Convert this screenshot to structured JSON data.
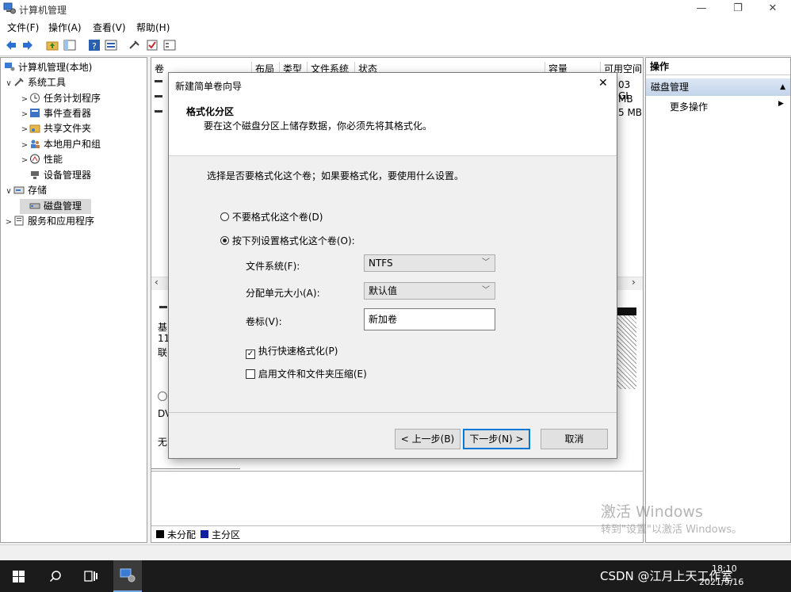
{
  "window": {
    "title": "计算机管理",
    "controls": {
      "minimize": "—",
      "maximize": "❐",
      "close": "✕"
    }
  },
  "menu": [
    "文件(F)",
    "操作(A)",
    "查看(V)",
    "帮助(H)"
  ],
  "tree": {
    "root": "计算机管理(本地)",
    "items": [
      {
        "label": "系统工具",
        "expander": "∨"
      },
      {
        "label": "任务计划程序",
        "expander": ">"
      },
      {
        "label": "事件查看器",
        "expander": ">"
      },
      {
        "label": "共享文件夹",
        "expander": ">"
      },
      {
        "label": "本地用户和组",
        "expander": ">"
      },
      {
        "label": "性能",
        "expander": ">"
      },
      {
        "label": "设备管理器",
        "expander": ""
      },
      {
        "label": "存储",
        "expander": "∨"
      },
      {
        "label": "磁盘管理",
        "expander": ""
      },
      {
        "label": "服务和应用程序",
        "expander": ">"
      }
    ]
  },
  "volume_list": {
    "columns": [
      "卷",
      "布局",
      "类型",
      "文件系统",
      "状态",
      "容量",
      "可用空间"
    ],
    "free_space_partial": [
      "03 GI",
      "MB",
      "5 MB"
    ]
  },
  "disk_map": {
    "partial_labels": [
      "基",
      "11",
      "联",
      "DV",
      "无"
    ],
    "legend": {
      "unallocated": "未分配",
      "primary": "主分区"
    }
  },
  "actions": {
    "header": "操作",
    "section": "磁盘管理",
    "more": "更多操作"
  },
  "watermark": {
    "line1": "激活 Windows",
    "line2": "转到\"设置\"以激活 Windows。"
  },
  "taskbar": {
    "tray_text": "CSDN @江月上天工作室",
    "time": "18:10",
    "date": "2021/9/16"
  },
  "dialog": {
    "title": "新建简单卷向导",
    "close": "✕",
    "heading": "格式化分区",
    "subheading": "要在这个磁盘分区上储存数据，你必须先将其格式化。",
    "prompt": "选择是否要格式化这个卷；如果要格式化，要使用什么设置。",
    "options": {
      "no_format": "不要格式化这个卷(D)",
      "format": "按下列设置格式化这个卷(O):"
    },
    "selected_option": "format",
    "fields": {
      "filesystem_label": "文件系统(F):",
      "filesystem_value": "NTFS",
      "unit_label": "分配单元大小(A):",
      "unit_value": "默认值",
      "volume_label_label": "卷标(V):",
      "volume_label_value": "新加卷"
    },
    "checkboxes": {
      "quick_format": "执行快速格式化(P)",
      "quick_format_checked": true,
      "compression": "启用文件和文件夹压缩(E)",
      "compression_checked": false
    },
    "buttons": {
      "back": "< 上一步(B)",
      "next": "下一步(N) >",
      "cancel": "取消"
    }
  }
}
